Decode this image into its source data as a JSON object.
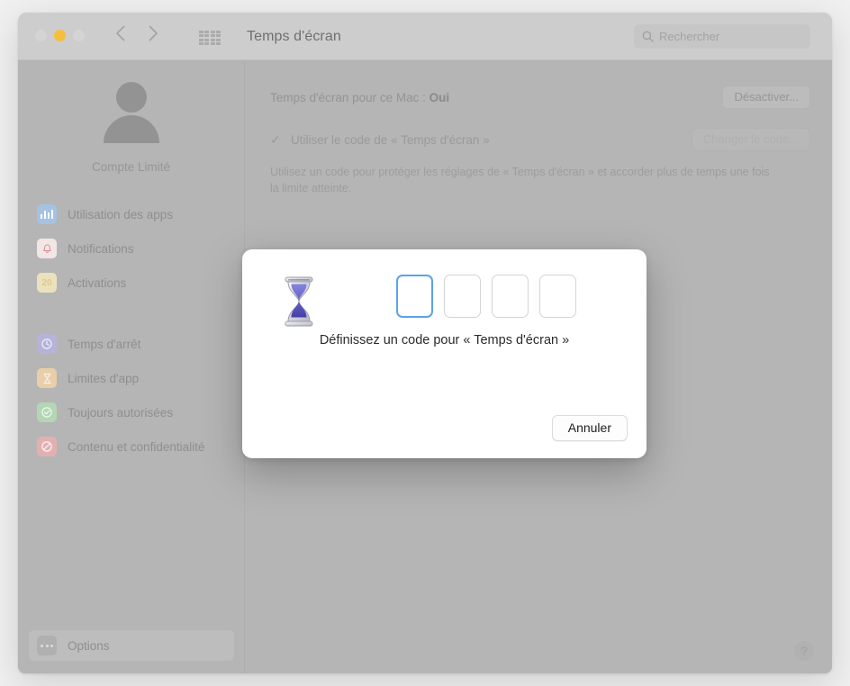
{
  "window": {
    "title": "Temps d'écran",
    "traffic_lights": [
      "close",
      "minimize",
      "zoom"
    ],
    "grid_icon": "show-all-grid-icon",
    "back_icon": "chevron-left-icon",
    "forward_icon": "chevron-right-icon"
  },
  "search": {
    "placeholder": "Rechercher",
    "icon": "search-icon"
  },
  "sidebar": {
    "account_name": "Compte Limité",
    "avatar_icon": "person-avatar-icon",
    "groups": [
      {
        "items": [
          {
            "label": "Utilisation des apps",
            "icon": "app-usage-icon"
          },
          {
            "label": "Notifications",
            "icon": "bell-icon"
          },
          {
            "label": "Activations",
            "icon": "pickups-icon"
          }
        ]
      },
      {
        "items": [
          {
            "label": "Temps d'arrêt",
            "icon": "downtime-clock-icon"
          },
          {
            "label": "Limites d'app",
            "icon": "app-limits-hourglass-icon"
          },
          {
            "label": "Toujours autorisées",
            "icon": "always-allowed-check-icon"
          },
          {
            "label": "Contenu et confidentialité",
            "icon": "content-privacy-prohibition-icon"
          }
        ]
      }
    ],
    "options": {
      "label": "Options",
      "icon": "ellipsis-icon"
    }
  },
  "content": {
    "status_prefix": "Temps d'écran pour ce Mac :",
    "status_value": "Oui",
    "turn_off_button": "Désactiver...",
    "checkbox_mark": "✓",
    "checkbox_label": "Utiliser le code de « Temps d'écran »",
    "change_code_button": "Changer le code...",
    "description": "Utilisez un code pour protéger les réglages de « Temps d'écran » et accorder plus de temps une fois la limite atteinte.",
    "help_label": "?"
  },
  "modal": {
    "icon": "hourglass-icon",
    "pin_boxes": [
      {
        "focused": true
      },
      {
        "focused": false
      },
      {
        "focused": false
      },
      {
        "focused": false
      }
    ],
    "prompt": "Définissez un code pour « Temps d'écran »",
    "cancel_button": "Annuler"
  },
  "colors": {
    "focus_blue": "#5ba2ec",
    "window_background": "#b5b5b5",
    "titlebar": "#cdcdcd",
    "modal_background": "#ffffff",
    "minimize_yellow": "#f5bf3d"
  }
}
